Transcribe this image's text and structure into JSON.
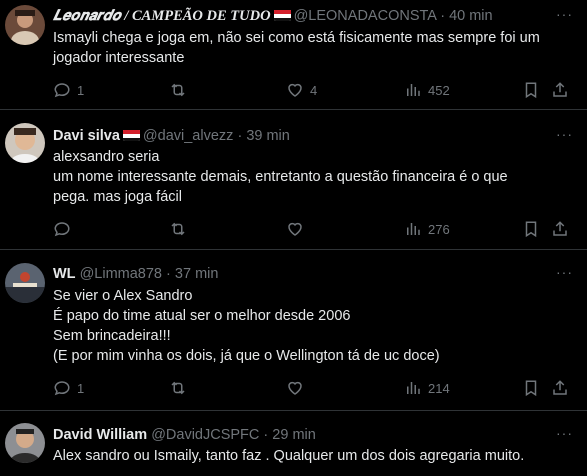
{
  "tweets": [
    {
      "name": "𝑳𝒆𝒐𝒏𝒂𝒓𝒅𝒐 / CAMPEÃO DE TUDO",
      "handle": "@LEONADACONSTA",
      "dot": "·",
      "time": "40 min",
      "lines": [
        "Ismayli chega e joga em, não sei como está fisicamente mas sempre foi um",
        "jogador interessante"
      ],
      "replies": "1",
      "retweets": "",
      "likes": "4",
      "views": "452"
    },
    {
      "name": "Davi silva",
      "handle": "@davi_alvezz",
      "dot": "·",
      "time": "39 min",
      "lines": [
        "alexsandro seria",
        "um nome interessante demais, entretanto a questão financeira é o que",
        "pega. mas joga fácil"
      ],
      "replies": "",
      "retweets": "",
      "likes": "",
      "views": "276"
    },
    {
      "name": "WL",
      "handle": "@Limma878",
      "dot": "·",
      "time": "37 min",
      "lines": [
        "Se vier o Alex Sandro",
        "É papo do time atual ser o melhor desde 2006",
        "Sem brincadeira!!!",
        "(E por mim vinha os dois, já que o Wellington tá de uc doce)"
      ],
      "replies": "1",
      "retweets": "",
      "likes": "",
      "views": "214"
    },
    {
      "name": "David William",
      "handle": "@DavidJCSPFC",
      "dot": "·",
      "time": "29 min",
      "lines": [
        "Alex sandro ou Ismaily, tanto faz . Qualquer um dos dois agregaria muito."
      ],
      "replies": "",
      "retweets": "",
      "likes": "",
      "views": ""
    }
  ],
  "more_label": "···",
  "colors": {
    "background": "#000000",
    "text": "#e7e9ea",
    "muted": "#71767b",
    "divider": "#2f3336"
  },
  "icons": [
    "reply-icon",
    "retweet-icon",
    "like-icon",
    "views-icon",
    "bookmark-icon",
    "share-icon",
    "flag-icon",
    "more-icon"
  ]
}
